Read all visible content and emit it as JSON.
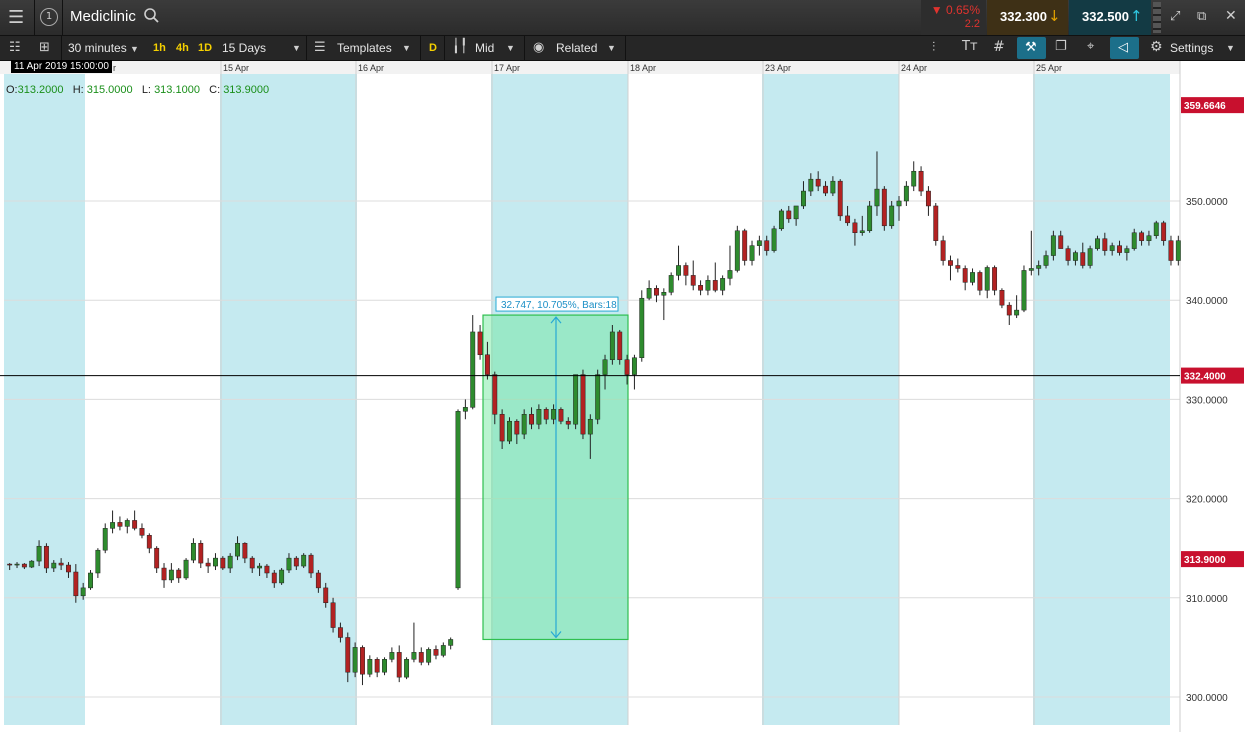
{
  "app": {
    "instrument": "Mediclinic",
    "change_pct": "▼ 0.65%",
    "change_abs": "2.2",
    "sell_price": "332.300",
    "buy_price": "332.500",
    "up_color": "#2e8b2e",
    "down_color": "#b22222",
    "accent": "#17a6c6"
  },
  "toolbar": {
    "interval": "30 minutes",
    "quick_1h": "1h",
    "quick_4h": "4h",
    "quick_1d": "1D",
    "range": "15 Days",
    "templates": "Templates",
    "d_badge": "D",
    "price_type": "Mid",
    "related": "Related",
    "settings": "Settings"
  },
  "icons": [
    "menu-icon",
    "info-circle-icon",
    "search-icon",
    "arrow-down-icon",
    "arrow-up-icon",
    "minimize-icon",
    "expand-icon",
    "popout-icon",
    "close-icon",
    "list-icon",
    "layout-icon",
    "templates-icon",
    "candlestick-icon",
    "eye-icon",
    "scale-icon",
    "font-size-icon",
    "grid-icon",
    "draw-icon",
    "layers-icon",
    "crosshair-icon",
    "tag-icon",
    "gear-icon"
  ],
  "tooltip": "11 Apr 2019 15:00:00",
  "ohlc": {
    "o_label": "O:",
    "o": "313.2000",
    "h_label": "H:",
    "h": "315.0000",
    "l_label": "L:",
    "l": "313.1000",
    "c_label": "C:",
    "c": "313.9000"
  },
  "chart_data": {
    "type": "candlestick",
    "x_labels": [
      "r",
      "15 Apr",
      "16 Apr",
      "17 Apr",
      "18 Apr",
      "23 Apr",
      "24 Apr",
      "25 Apr"
    ],
    "y_ticks": [
      "300.0000",
      "310.0000",
      "320.0000",
      "330.0000",
      "340.0000",
      "350.0000"
    ],
    "ylim": [
      298,
      362
    ],
    "markers": {
      "high": "359.6646",
      "current": "332.4000",
      "close": "313.9000"
    },
    "measure_label": "32.747, 10.705%, Bars:18",
    "measure_range": [
      305.8,
      338.5
    ],
    "grid": true,
    "session_shading": true,
    "candles": [
      [
        313.4,
        313.5,
        312.8,
        313.3
      ],
      [
        313.3,
        313.6,
        313.0,
        313.4
      ],
      [
        313.4,
        313.5,
        312.9,
        313.1
      ],
      [
        313.1,
        313.8,
        313.0,
        313.7
      ],
      [
        313.7,
        315.8,
        313.2,
        315.2
      ],
      [
        315.2,
        315.5,
        312.5,
        313.0
      ],
      [
        313.0,
        313.8,
        312.6,
        313.5
      ],
      [
        313.5,
        314.0,
        312.8,
        313.3
      ],
      [
        313.3,
        313.6,
        312.0,
        312.6
      ],
      [
        312.6,
        313.4,
        309.5,
        310.2
      ],
      [
        310.2,
        311.5,
        309.8,
        311.0
      ],
      [
        311.0,
        312.8,
        310.8,
        312.5
      ],
      [
        312.5,
        315.0,
        312.0,
        314.8
      ],
      [
        314.8,
        317.5,
        314.5,
        317.0
      ],
      [
        317.0,
        318.8,
        316.5,
        317.6
      ],
      [
        317.6,
        318.2,
        316.8,
        317.2
      ],
      [
        317.2,
        318.0,
        316.5,
        317.8
      ],
      [
        317.8,
        318.8,
        316.8,
        317.0
      ],
      [
        317.0,
        317.5,
        316.0,
        316.3
      ],
      [
        316.3,
        316.5,
        314.5,
        315.0
      ],
      [
        315.0,
        315.2,
        312.5,
        313.0
      ],
      [
        313.0,
        313.5,
        311.0,
        311.8
      ],
      [
        311.8,
        313.5,
        311.5,
        312.8
      ],
      [
        312.8,
        313.0,
        311.5,
        312.0
      ],
      [
        312.0,
        314.0,
        311.8,
        313.8
      ],
      [
        313.8,
        316.0,
        313.5,
        315.5
      ],
      [
        315.5,
        315.8,
        313.0,
        313.5
      ],
      [
        313.5,
        314.0,
        312.5,
        313.2
      ],
      [
        313.2,
        314.5,
        312.8,
        314.0
      ],
      [
        314.0,
        314.2,
        312.8,
        313.0
      ],
      [
        313.0,
        314.5,
        312.5,
        314.2
      ],
      [
        314.2,
        316.2,
        313.8,
        315.5
      ],
      [
        315.5,
        315.6,
        313.5,
        314.0
      ],
      [
        314.0,
        314.2,
        312.5,
        313.0
      ],
      [
        313.0,
        313.5,
        312.2,
        313.2
      ],
      [
        313.2,
        313.4,
        312.0,
        312.5
      ],
      [
        312.5,
        312.8,
        311.0,
        311.5
      ],
      [
        311.5,
        313.0,
        311.3,
        312.8
      ],
      [
        312.8,
        314.5,
        312.5,
        314.0
      ],
      [
        314.0,
        314.2,
        312.8,
        313.2
      ],
      [
        313.2,
        314.5,
        313.0,
        314.3
      ],
      [
        314.3,
        314.5,
        312.0,
        312.5
      ],
      [
        312.5,
        312.8,
        310.5,
        311.0
      ],
      [
        311.0,
        311.5,
        309.0,
        309.5
      ],
      [
        309.5,
        310.0,
        306.5,
        307.0
      ],
      [
        307.0,
        307.5,
        305.5,
        306.0
      ],
      [
        306.0,
        306.5,
        301.5,
        302.5
      ],
      [
        302.5,
        305.5,
        302.0,
        305.0
      ],
      [
        305.0,
        305.2,
        301.2,
        302.3
      ],
      [
        302.3,
        304.2,
        302.0,
        303.8
      ],
      [
        303.8,
        304.0,
        302.0,
        302.5
      ],
      [
        302.5,
        304.0,
        302.2,
        303.8
      ],
      [
        303.8,
        305.0,
        303.5,
        304.5
      ],
      [
        304.5,
        305.2,
        301.5,
        302.0
      ],
      [
        302.0,
        304.0,
        301.8,
        303.8
      ],
      [
        303.8,
        307.5,
        303.5,
        304.5
      ],
      [
        304.5,
        305.0,
        303.2,
        303.5
      ],
      [
        303.5,
        305.0,
        303.2,
        304.8
      ],
      [
        304.8,
        305.2,
        303.8,
        304.2
      ],
      [
        304.2,
        305.5,
        304.0,
        305.2
      ],
      [
        305.2,
        306.0,
        304.8,
        305.8
      ],
      [
        311.0,
        329.0,
        310.8,
        328.8
      ],
      [
        328.8,
        330.0,
        328.0,
        329.2
      ],
      [
        329.2,
        338.5,
        329.0,
        336.8
      ],
      [
        336.8,
        337.5,
        334.0,
        334.5
      ],
      [
        334.5,
        335.8,
        332.0,
        332.5
      ],
      [
        332.5,
        332.8,
        327.5,
        328.5
      ],
      [
        328.5,
        329.0,
        325.0,
        325.8
      ],
      [
        325.8,
        328.2,
        325.5,
        327.8
      ],
      [
        327.8,
        328.0,
        325.5,
        326.5
      ],
      [
        326.5,
        329.0,
        326.0,
        328.5
      ],
      [
        328.5,
        329.2,
        327.0,
        327.5
      ],
      [
        327.5,
        329.5,
        327.0,
        329.0
      ],
      [
        329.0,
        329.2,
        327.5,
        328.0
      ],
      [
        328.0,
        329.5,
        327.5,
        329.0
      ],
      [
        329.0,
        329.2,
        327.5,
        327.8
      ],
      [
        327.8,
        328.2,
        327.0,
        327.5
      ],
      [
        327.5,
        332.5,
        327.0,
        332.5
      ],
      [
        332.5,
        333.0,
        326.0,
        326.5
      ],
      [
        326.5,
        328.5,
        324.0,
        328.0
      ],
      [
        328.0,
        333.0,
        327.5,
        332.5
      ],
      [
        332.5,
        334.5,
        331.0,
        334.0
      ],
      [
        334.0,
        337.5,
        333.5,
        336.8
      ],
      [
        336.8,
        337.0,
        333.5,
        334.0
      ],
      [
        334.0,
        334.5,
        331.5,
        332.5
      ],
      [
        332.5,
        334.5,
        331.0,
        334.2
      ],
      [
        334.2,
        341.0,
        333.8,
        340.2
      ],
      [
        340.2,
        342.0,
        340.0,
        341.2
      ],
      [
        341.2,
        341.5,
        339.8,
        340.5
      ],
      [
        340.5,
        341.2,
        338.0,
        340.8
      ],
      [
        340.8,
        342.8,
        340.5,
        342.5
      ],
      [
        342.5,
        345.5,
        342.0,
        343.5
      ],
      [
        343.5,
        343.8,
        341.5,
        342.5
      ],
      [
        342.5,
        344.0,
        341.0,
        341.5
      ],
      [
        341.5,
        342.0,
        340.5,
        341.0
      ],
      [
        341.0,
        342.5,
        340.5,
        342.0
      ],
      [
        342.0,
        343.8,
        340.8,
        341.0
      ],
      [
        341.0,
        342.5,
        340.5,
        342.2
      ],
      [
        342.2,
        345.5,
        341.5,
        343.0
      ],
      [
        343.0,
        347.5,
        342.8,
        347.0
      ],
      [
        347.0,
        347.2,
        343.5,
        344.0
      ],
      [
        344.0,
        346.0,
        343.5,
        345.5
      ],
      [
        345.5,
        346.5,
        344.5,
        346.0
      ],
      [
        346.0,
        346.5,
        344.5,
        345.0
      ],
      [
        345.0,
        347.5,
        344.8,
        347.2
      ],
      [
        347.2,
        349.2,
        347.0,
        349.0
      ],
      [
        349.0,
        349.5,
        347.8,
        348.2
      ],
      [
        348.2,
        349.5,
        347.5,
        349.5
      ],
      [
        349.5,
        352.0,
        349.2,
        351.0
      ],
      [
        351.0,
        352.8,
        350.5,
        352.2
      ],
      [
        352.2,
        353.0,
        351.0,
        351.5
      ],
      [
        351.5,
        352.0,
        350.5,
        350.8
      ],
      [
        350.8,
        352.5,
        350.5,
        352.0
      ],
      [
        352.0,
        352.2,
        348.0,
        348.5
      ],
      [
        348.5,
        349.5,
        347.5,
        347.8
      ],
      [
        347.8,
        348.2,
        345.5,
        346.8
      ],
      [
        346.8,
        348.5,
        346.5,
        347.0
      ],
      [
        347.0,
        350.0,
        346.8,
        349.5
      ],
      [
        349.5,
        355.0,
        348.5,
        351.2
      ],
      [
        351.2,
        351.5,
        347.0,
        347.5
      ],
      [
        347.5,
        350.0,
        347.2,
        349.5
      ],
      [
        349.5,
        350.5,
        348.0,
        350.0
      ],
      [
        350.0,
        352.0,
        349.5,
        351.5
      ],
      [
        351.5,
        354.0,
        351.0,
        353.0
      ],
      [
        353.0,
        353.5,
        350.5,
        351.0
      ],
      [
        351.0,
        351.5,
        348.5,
        349.5
      ],
      [
        349.5,
        349.8,
        345.5,
        346.0
      ],
      [
        346.0,
        346.5,
        343.5,
        344.0
      ],
      [
        344.0,
        344.5,
        342.0,
        343.5
      ],
      [
        343.5,
        344.2,
        342.8,
        343.2
      ],
      [
        343.2,
        343.5,
        341.0,
        341.8
      ],
      [
        341.8,
        343.2,
        341.5,
        342.8
      ],
      [
        342.8,
        343.0,
        340.5,
        341.0
      ],
      [
        341.0,
        343.5,
        340.2,
        343.3
      ],
      [
        343.3,
        343.5,
        340.5,
        341.0
      ],
      [
        341.0,
        341.2,
        339.2,
        339.5
      ],
      [
        339.5,
        339.8,
        337.5,
        338.5
      ],
      [
        338.5,
        340.5,
        338.2,
        339.0
      ],
      [
        339.0,
        343.5,
        338.8,
        343.0
      ],
      [
        343.0,
        347.0,
        342.5,
        343.2
      ],
      [
        343.2,
        344.0,
        342.5,
        343.5
      ],
      [
        343.5,
        345.0,
        343.2,
        344.5
      ],
      [
        344.5,
        347.0,
        344.0,
        346.5
      ],
      [
        346.5,
        347.0,
        345.5,
        345.2
      ],
      [
        345.2,
        345.5,
        343.5,
        344.0
      ],
      [
        344.0,
        345.0,
        343.5,
        344.8
      ],
      [
        344.8,
        345.8,
        343.2,
        343.5
      ],
      [
        343.5,
        345.5,
        343.2,
        345.2
      ],
      [
        345.2,
        346.5,
        345.0,
        346.2
      ],
      [
        346.2,
        346.8,
        344.5,
        345.0
      ],
      [
        345.0,
        345.8,
        344.5,
        345.5
      ],
      [
        345.5,
        346.0,
        344.5,
        344.8
      ],
      [
        344.8,
        345.5,
        344.0,
        345.2
      ],
      [
        345.2,
        347.2,
        345.0,
        346.8
      ],
      [
        346.8,
        347.0,
        345.5,
        346.0
      ],
      [
        346.0,
        347.0,
        345.5,
        346.5
      ],
      [
        346.5,
        348.0,
        346.2,
        347.8
      ],
      [
        347.8,
        348.0,
        345.5,
        346.0
      ],
      [
        346.0,
        346.5,
        343.5,
        344.0
      ],
      [
        344.0,
        346.5,
        343.5,
        346.0
      ]
    ]
  }
}
